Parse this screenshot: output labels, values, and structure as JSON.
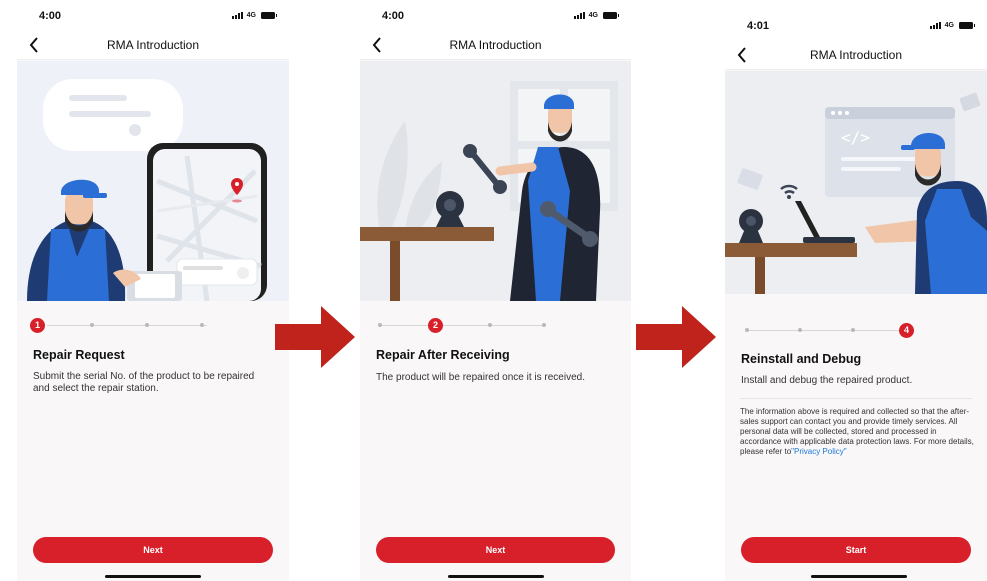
{
  "screens": [
    {
      "status": {
        "time": "4:00",
        "network": "4G"
      },
      "nav": {
        "title": "RMA Introduction"
      },
      "step": {
        "active": 1,
        "active_label": "1",
        "total": 4
      },
      "title": "Repair Request",
      "description": "Submit the serial No. of the product to be repaired and select the repair station.",
      "button": "Next"
    },
    {
      "status": {
        "time": "4:00",
        "network": "4G"
      },
      "nav": {
        "title": "RMA Introduction"
      },
      "step": {
        "active": 2,
        "active_label": "2",
        "total": 4
      },
      "title": "Repair After Receiving",
      "description": "The product will be repaired once it is received.",
      "button": "Next"
    },
    {
      "status": {
        "time": "4:01",
        "network": "4G"
      },
      "nav": {
        "title": "RMA Introduction"
      },
      "step": {
        "active": 4,
        "active_label": "4",
        "total": 4
      },
      "title": "Reinstall and Debug",
      "description": "Install and debug the repaired product.",
      "notice": "The information above is required and collected so that the after-sales support can contact you and provide timely services. All personal data will be collected, stored and processed in accordance with applicable data protection laws. For more details, please refer to",
      "privacy_link": "\"Privacy Policy\"",
      "button": "Start"
    }
  ],
  "colors": {
    "accent": "#d7202a",
    "link": "#1d7ad8",
    "arrow": "#c0231c",
    "worker_blue": "#2b6fd6"
  },
  "icons": [
    "back-arrow-icon",
    "signal-icon",
    "battery-icon",
    "location-pin-icon",
    "wifi-icon",
    "wrench-icon",
    "code-icon"
  ]
}
